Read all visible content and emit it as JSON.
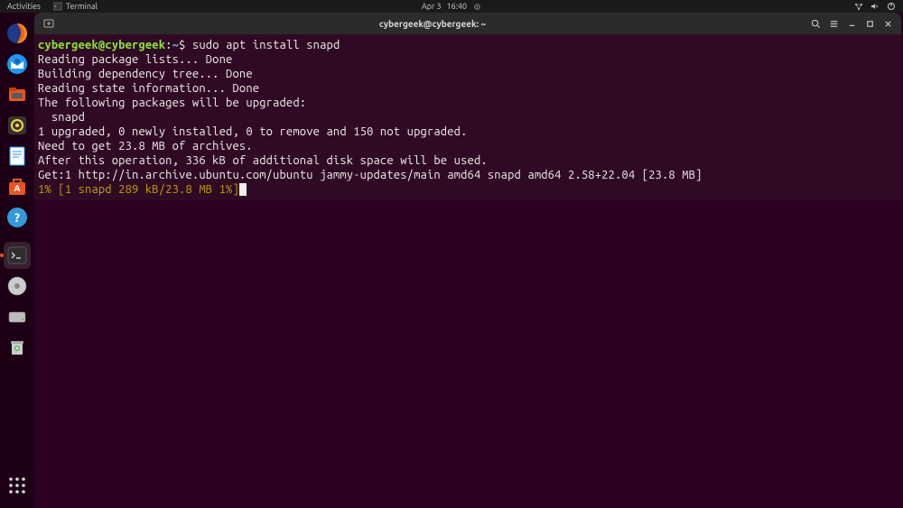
{
  "topbar": {
    "activities": "Activities",
    "app_label": "Terminal",
    "date": "Apr 3",
    "time": "16:40"
  },
  "window": {
    "title": "cybergeek@cybergeek: ~"
  },
  "terminal": {
    "prompt_user": "cybergeek@cybergeek",
    "prompt_colon": ":",
    "prompt_path": "~",
    "prompt_dollar": "$ ",
    "command": "sudo apt install snapd",
    "lines": [
      "Reading package lists... Done",
      "Building dependency tree... Done",
      "Reading state information... Done",
      "The following packages will be upgraded:",
      "  snapd",
      "1 upgraded, 0 newly installed, 0 to remove and 150 not upgraded.",
      "Need to get 23.8 MB of archives.",
      "After this operation, 336 kB of additional disk space will be used.",
      "Get:1 http://in.archive.ubuntu.com/ubuntu jammy-updates/main amd64 snapd amd64 2.58+22.04 [23.8 MB]"
    ],
    "progress": "1% [1 snapd 289 kB/23.8 MB 1%]"
  }
}
